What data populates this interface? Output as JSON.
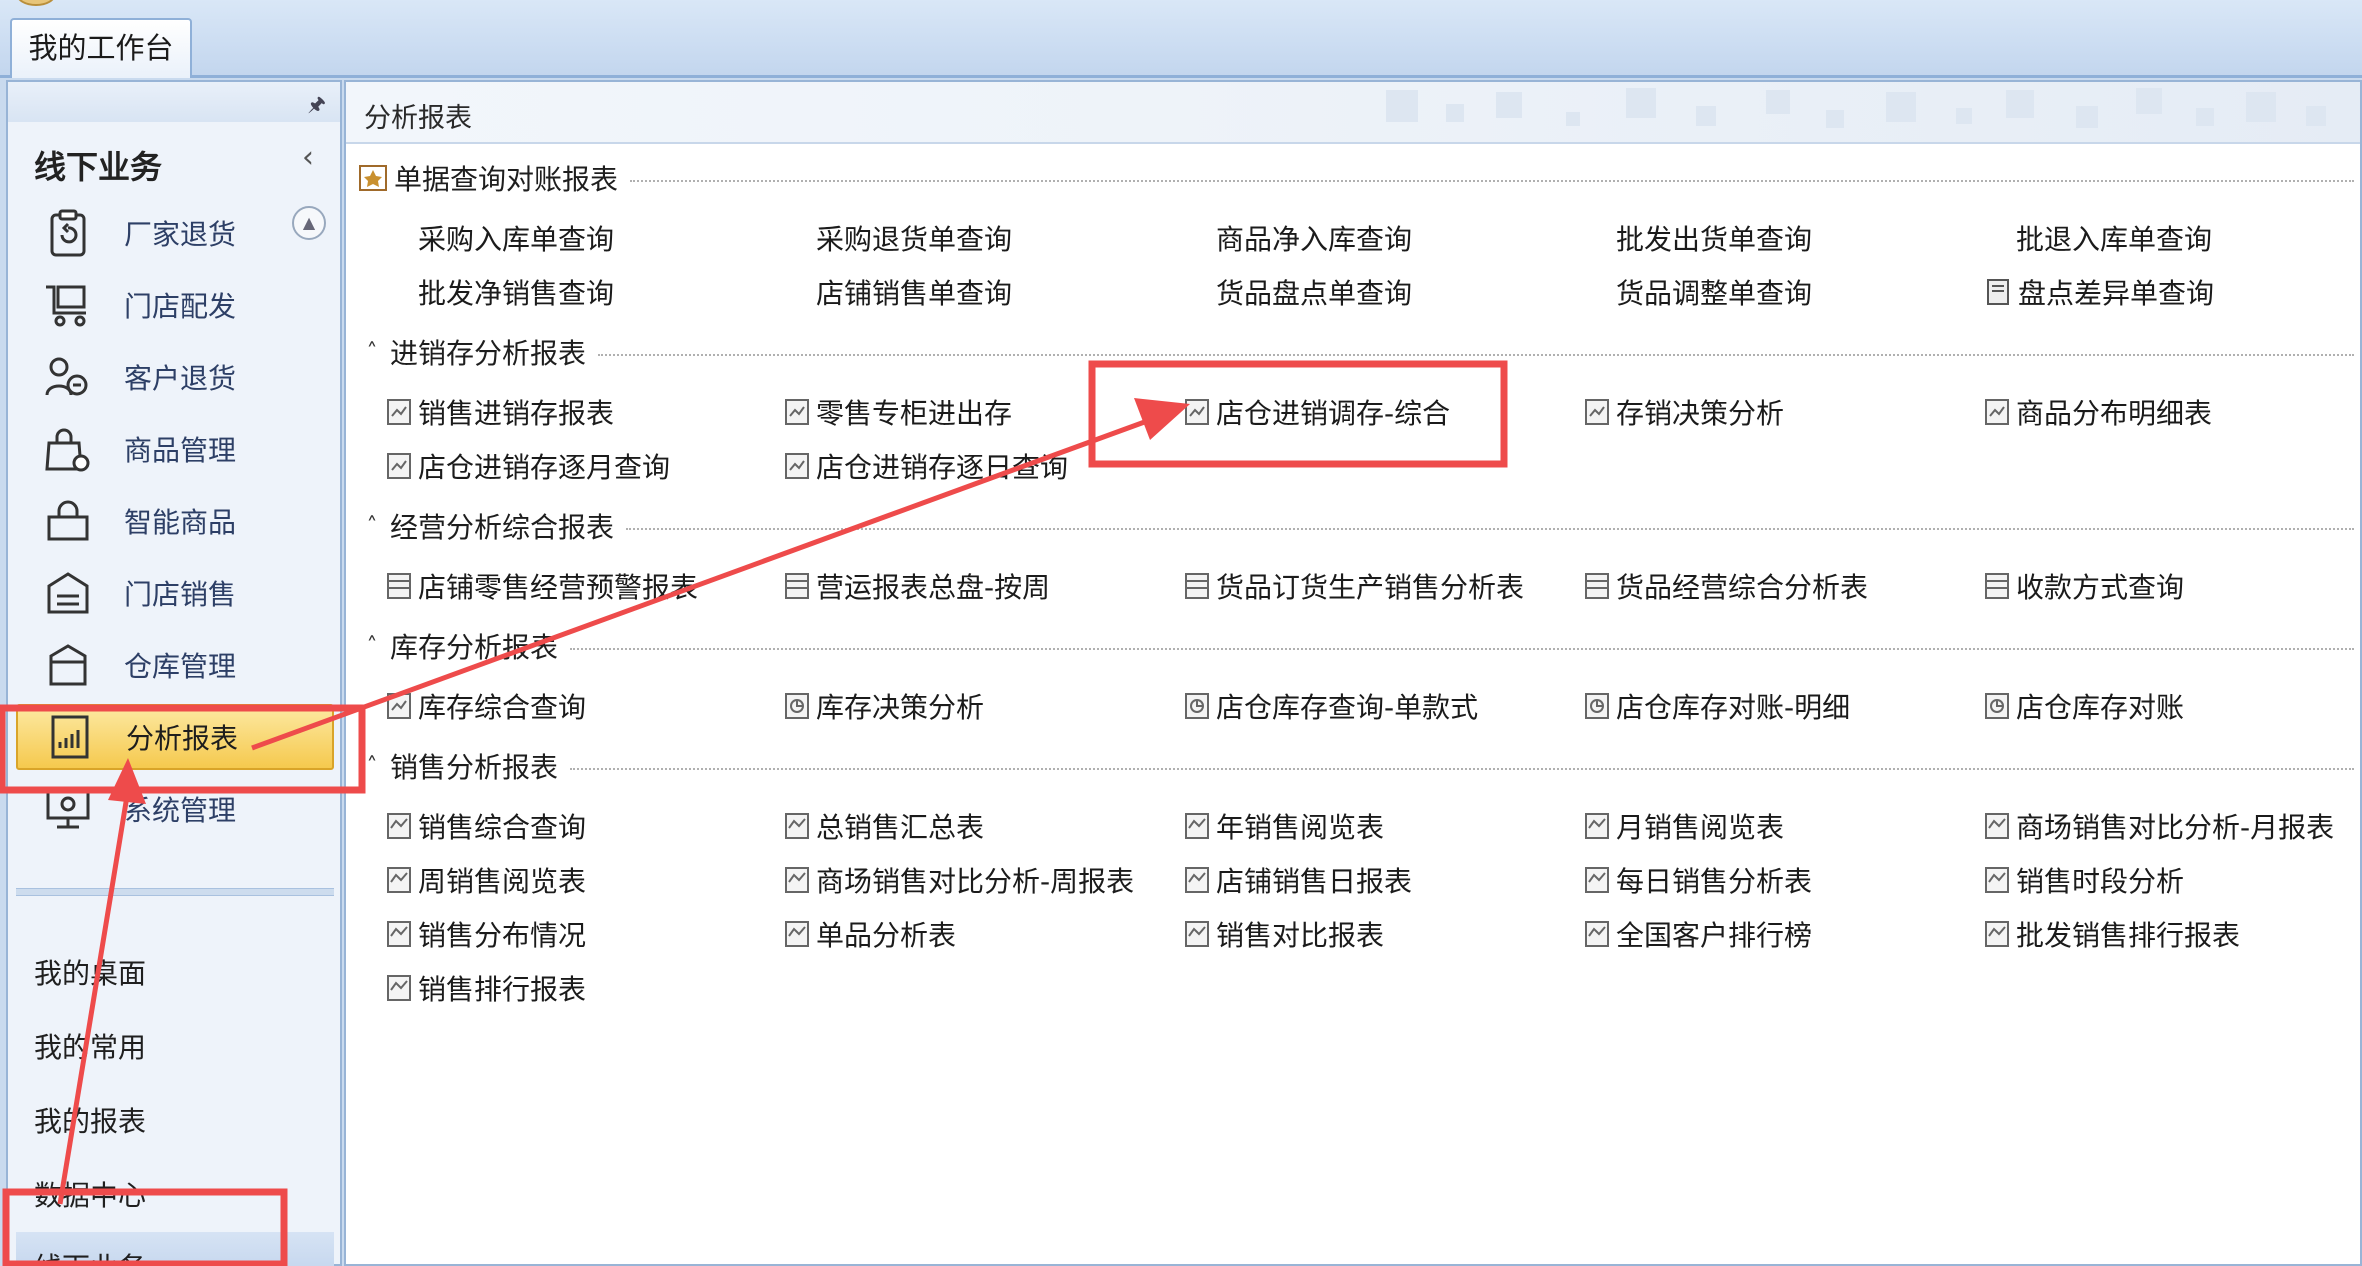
{
  "window": {
    "tab_label": "我的工作台"
  },
  "sidebar": {
    "group_title": "线下业务",
    "items": [
      {
        "label": "厂家退货",
        "icon": "clipboard-return-icon"
      },
      {
        "label": "门店配发",
        "icon": "cart-icon"
      },
      {
        "label": "客户退货",
        "icon": "customer-return-icon"
      },
      {
        "label": "商品管理",
        "icon": "bag-gear-icon"
      },
      {
        "label": "智能商品",
        "icon": "shopping-bag-icon"
      },
      {
        "label": "门店销售",
        "icon": "store-sales-icon"
      },
      {
        "label": "仓库管理",
        "icon": "warehouse-box-icon"
      },
      {
        "label": "分析报表",
        "icon": "report-chart-icon"
      },
      {
        "label": "系统管理",
        "icon": "monitor-gear-icon"
      }
    ],
    "bottom_items": [
      "我的桌面",
      "我的常用",
      "我的报表",
      "数据中心",
      "线下业务"
    ]
  },
  "content": {
    "title": "分析报表",
    "sections": [
      {
        "title": "单据查询对账报表",
        "items": [
          "采购入库单查询",
          "采购退货单查询",
          "商品净入库查询",
          "批发出货单查询",
          "批退入库单查询",
          "批发净销售查询",
          "店铺销售单查询",
          "货品盘点单查询",
          "货品调整单查询",
          "盘点差异单查询"
        ]
      },
      {
        "title": "进销存分析报表",
        "items": [
          "销售进销存报表",
          "零售专柜进出存",
          "店仓进销调存-综合",
          "存销决策分析",
          "商品分布明细表",
          "店仓进销存逐月查询",
          "店仓进销存逐日查询"
        ]
      },
      {
        "title": "经营分析综合报表",
        "items": [
          "店铺零售经营预警报表",
          "营运报表总盘-按周",
          "货品订货生产销售分析表",
          "货品经营综合分析表",
          "收款方式查询"
        ]
      },
      {
        "title": "库存分析报表",
        "items": [
          "库存综合查询",
          "库存决策分析",
          "店仓库存查询-单款式",
          "店仓库存对账-明细",
          "店仓库存对账"
        ]
      },
      {
        "title": "销售分析报表",
        "items": [
          "销售综合查询",
          "总销售汇总表",
          "年销售阅览表",
          "月销售阅览表",
          "商场销售对比分析-月报表",
          "周销售阅览表",
          "商场销售对比分析-周报表",
          "店铺销售日报表",
          "每日销售分析表",
          "销售时段分析",
          "销售分布情况",
          "单品分析表",
          "销售对比报表",
          "全国客户排行榜",
          "批发销售排行报表",
          "销售排行报表"
        ]
      }
    ]
  },
  "colors": {
    "annotation": "#ee4b4b",
    "active_nav": "#f5c94e",
    "link_text": "#2d3f66"
  }
}
